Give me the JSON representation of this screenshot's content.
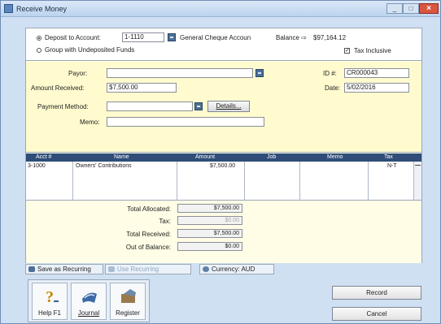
{
  "window": {
    "title": "Receive Money"
  },
  "deposit": {
    "option_deposit_label": "Deposit to Account:",
    "account_number": "1-1110",
    "account_name": "General Cheque Accoun",
    "balance_label": "Balance ⇨",
    "balance_value": "$97,164.12",
    "option_group_label": "Group with Undeposited Funds",
    "tax_inclusive_label": "Tax Inclusive"
  },
  "form": {
    "payor_label": "Payor:",
    "payor_value": "",
    "id_label": "ID #:",
    "id_value": "CR000043",
    "amount_label": "Amount Received:",
    "amount_value": "$7,500.00",
    "date_label": "Date:",
    "date_value": "5/02/2016",
    "payment_method_label": "Payment Method:",
    "payment_method_value": "",
    "details_button": "Details...",
    "memo_label": "Memo:",
    "memo_value": ""
  },
  "grid": {
    "headers": [
      "Acct #",
      "Name",
      "Amount",
      "Job",
      "Memo",
      "Tax"
    ],
    "rows": [
      {
        "acct": "3-1000",
        "name": "Owners' Contributions",
        "amount": "$7,500.00",
        "job": "",
        "memo": "",
        "tax": "N-T"
      }
    ]
  },
  "totals": {
    "allocated_label": "Total Allocated:",
    "allocated_value": "$7,500.00",
    "tax_label": "Tax:",
    "tax_value": "$0.00",
    "received_label": "Total Received:",
    "received_value": "$7,500.00",
    "out_of_balance_label": "Out of Balance:",
    "out_of_balance_value": "$0.00"
  },
  "tabs": {
    "save_recurring": "Save as Recurring",
    "use_recurring": "Use Recurring",
    "currency": "Currency: AUD"
  },
  "toolbar": {
    "help_label": "Help F1",
    "journal_label": "Journal",
    "register_label": "Register"
  },
  "actions": {
    "record_label": "Record",
    "cancel_label": "Cancel"
  }
}
